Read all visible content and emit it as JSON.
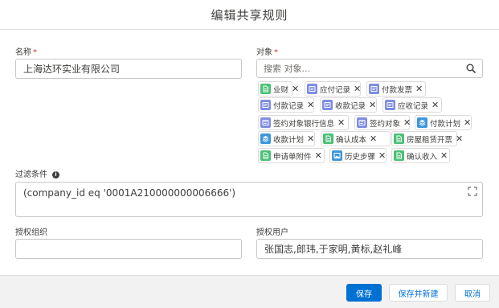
{
  "modal": {
    "title": "编辑共享规则"
  },
  "name_field": {
    "label": "名称",
    "required_mark": "*",
    "value": "上海达环实业有限公司"
  },
  "object_field": {
    "label": "对象",
    "required_mark": "*",
    "search_placeholder": "搜索 对象...",
    "pills": [
      {
        "label": "业财",
        "icon": "document-icon",
        "color": "#4bc076"
      },
      {
        "label": "应付记录",
        "icon": "record-icon",
        "color": "#7f8de1"
      },
      {
        "label": "付款发票",
        "icon": "record-icon",
        "color": "#7f8de1"
      },
      {
        "label": "付款记录",
        "icon": "record-icon",
        "color": "#7f8de1"
      },
      {
        "label": "收款记录",
        "icon": "record-icon",
        "color": "#7f8de1"
      },
      {
        "label": "应收记录",
        "icon": "record-icon",
        "color": "#7f8de1"
      },
      {
        "label": "签约对象银行信息",
        "icon": "record-icon",
        "color": "#7f8de1"
      },
      {
        "label": "签约对象",
        "icon": "record-icon",
        "color": "#7f8de1"
      },
      {
        "label": "付款计划",
        "icon": "stack-icon",
        "color": "#3c97dd"
      },
      {
        "label": "收款计划",
        "icon": "stack-icon",
        "color": "#3c97dd"
      },
      {
        "label": "确认成本",
        "icon": "document-icon",
        "color": "#4bc076"
      },
      {
        "label": "房屋租赁开票",
        "icon": "document-icon",
        "color": "#4bc076"
      },
      {
        "label": "申请单附件",
        "icon": "document-icon",
        "color": "#4bc076"
      },
      {
        "label": "历史步骤",
        "icon": "image-icon",
        "color": "#3c97dd"
      },
      {
        "label": "确认收入",
        "icon": "document-icon",
        "color": "#4bc076"
      }
    ]
  },
  "filter_field": {
    "label": "过滤条件",
    "value": "(company_id eq '0001A210000000006666')"
  },
  "org_field": {
    "label": "授权组织",
    "value": ""
  },
  "users_field": {
    "label": "授权用户",
    "value": "张国志,郎玮,于家明,黄标,赵礼峰"
  },
  "footer": {
    "save_label": "保存",
    "save_new_label": "保存并新建",
    "cancel_label": "取消"
  },
  "colors": {
    "primary": "#0070d2",
    "required": "#c23934",
    "border": "#c9c7c5"
  }
}
